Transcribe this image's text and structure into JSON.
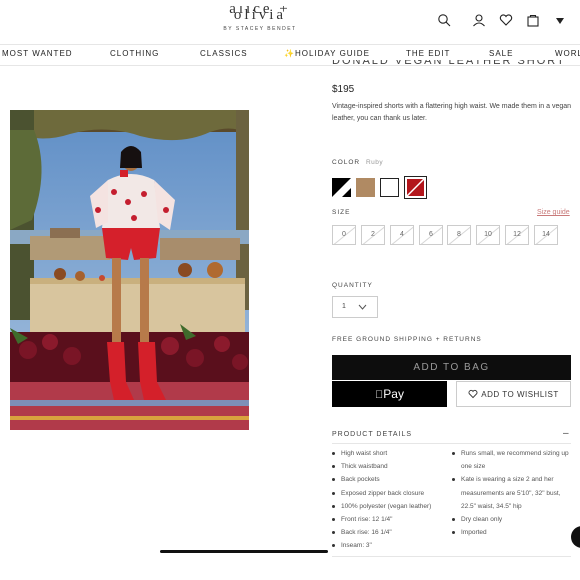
{
  "header": {
    "logo_main": "alice + olivia",
    "logo_sub": "BY STACEY BENDET",
    "icons": [
      "search-icon",
      "user-icon",
      "heart-icon",
      "bag-icon",
      "chevron-down-icon"
    ]
  },
  "nav": {
    "items": [
      {
        "label": "MOST WANTED"
      },
      {
        "label": "CLOTHING"
      },
      {
        "label": "CLASSICS"
      },
      {
        "label": "✨HOLIDAY GUIDE"
      },
      {
        "label": "THE EDIT"
      },
      {
        "label": "SALE"
      },
      {
        "label": "WORLD"
      }
    ]
  },
  "product": {
    "title": "DONALD VEGAN LEATHER SHORT",
    "price": "$195",
    "description": "Vintage-inspired shorts with a flattering high waist. We made them in a vegan leather, you can thank us later.",
    "color_label": "COLOR",
    "color_value": "Ruby",
    "swatches": [
      {
        "name": "black-white",
        "color": "#000000"
      },
      {
        "name": "tan",
        "color": "#b08a63"
      },
      {
        "name": "white",
        "color": "#ffffff"
      },
      {
        "name": "ruby",
        "color": "#b3161c"
      }
    ],
    "size_label": "SIZE",
    "size_guide": "Size guide",
    "sizes": [
      "0",
      "2",
      "4",
      "6",
      "8",
      "10",
      "12",
      "14"
    ],
    "quantity_label": "QUANTITY",
    "quantity_value": "1",
    "shipping": "FREE GROUND SHIPPING + RETURNS",
    "add_to_bag": "ADD TO BAG",
    "apple_pay": "Pay",
    "wishlist": "ADD TO WISHLIST"
  },
  "details": {
    "heading": "PRODUCT DETAILS",
    "toggle": "–",
    "left": [
      "High waist short",
      "Thick waistband",
      "Back pockets",
      "Exposed zipper back closure",
      "100% polyester (vegan leather)",
      "Front rise: 12 1/4\"",
      "Back rise: 16 1/4\"",
      "Inseam: 3\""
    ],
    "right": [
      "Runs small, we recommend sizing up one size",
      "Kate is wearing a size 2 and her measurements are 5'10\", 32\" bust, 22.5\" waist, 34.5\" hip",
      "Dry clean only",
      "Imported"
    ]
  },
  "colors": {
    "accent_link": "#c97a7a",
    "button_dark": "#0d0d0d"
  }
}
